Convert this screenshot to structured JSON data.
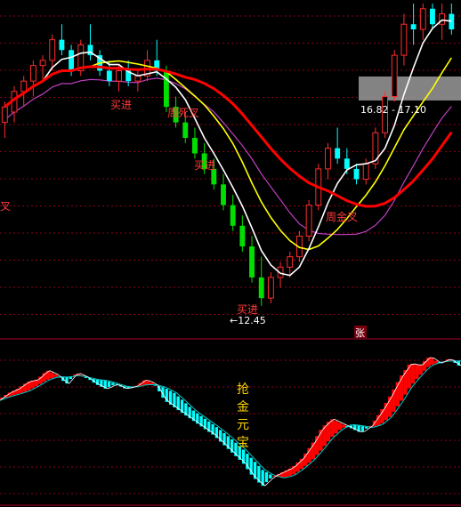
{
  "chart_data": [
    {
      "type": "candlestick",
      "panel": "price",
      "ylim": [
        12.0,
        18.3
      ],
      "grid": true,
      "colors": {
        "up": "#ff2d2d",
        "down": "#00ffff",
        "down_strong": "#00e000",
        "ma5": "#ffffff",
        "ma10": "#ffff00",
        "ma20": "#ff0000",
        "ma60": "#c040c0"
      },
      "candles": [
        [
          16.0,
          16.4,
          15.7,
          16.3
        ],
        [
          16.2,
          16.7,
          16.0,
          16.6
        ],
        [
          16.6,
          16.9,
          16.3,
          16.8
        ],
        [
          16.8,
          17.2,
          16.5,
          17.1
        ],
        [
          17.1,
          17.3,
          16.8,
          17.2
        ],
        [
          17.2,
          17.7,
          17.0,
          17.6
        ],
        [
          17.6,
          17.9,
          17.3,
          17.4
        ],
        [
          17.4,
          17.5,
          16.9,
          17.0
        ],
        [
          17.0,
          17.6,
          16.9,
          17.5
        ],
        [
          17.5,
          17.9,
          17.2,
          17.3
        ],
        [
          17.3,
          17.4,
          16.9,
          17.0
        ],
        [
          17.0,
          17.2,
          16.7,
          16.8
        ],
        [
          16.8,
          17.1,
          16.6,
          17.0
        ],
        [
          17.0,
          17.2,
          16.7,
          16.8
        ],
        [
          16.8,
          17.0,
          16.6,
          16.9
        ],
        [
          16.9,
          17.4,
          16.8,
          17.2
        ],
        [
          17.2,
          17.6,
          16.9,
          17.0
        ],
        [
          17.0,
          17.1,
          16.2,
          16.3
        ],
        [
          16.3,
          16.5,
          15.9,
          16.0
        ],
        [
          16.0,
          16.2,
          15.6,
          15.7
        ],
        [
          15.7,
          15.9,
          15.3,
          15.4
        ],
        [
          15.4,
          15.6,
          15.0,
          15.1
        ],
        [
          15.1,
          15.3,
          14.7,
          14.8
        ],
        [
          14.8,
          15.0,
          14.3,
          14.4
        ],
        [
          14.4,
          14.6,
          13.9,
          14.0
        ],
        [
          14.0,
          14.2,
          13.5,
          13.6
        ],
        [
          13.6,
          13.8,
          12.9,
          13.0
        ],
        [
          13.0,
          13.4,
          12.45,
          12.6
        ],
        [
          12.6,
          13.1,
          12.5,
          13.0
        ],
        [
          13.0,
          13.3,
          12.8,
          13.2
        ],
        [
          13.2,
          13.5,
          13.0,
          13.4
        ],
        [
          13.4,
          13.9,
          13.3,
          13.8
        ],
        [
          13.8,
          14.5,
          13.7,
          14.4
        ],
        [
          14.4,
          15.2,
          14.3,
          15.1
        ],
        [
          15.1,
          15.6,
          14.9,
          15.5
        ],
        [
          15.5,
          15.9,
          15.2,
          15.3
        ],
        [
          15.3,
          15.5,
          15.0,
          15.1
        ],
        [
          15.1,
          15.2,
          14.8,
          14.9
        ],
        [
          14.9,
          15.3,
          14.8,
          15.2
        ],
        [
          15.2,
          15.9,
          15.1,
          15.8
        ],
        [
          15.8,
          16.6,
          15.7,
          16.5
        ],
        [
          16.5,
          17.4,
          16.4,
          17.3
        ],
        [
          17.3,
          18.1,
          17.1,
          17.9
        ],
        [
          17.9,
          18.3,
          17.5,
          17.8
        ],
        [
          17.8,
          18.3,
          17.6,
          18.2
        ],
        [
          18.2,
          18.3,
          17.8,
          17.9
        ],
        [
          17.9,
          18.3,
          17.6,
          18.1
        ],
        [
          18.1,
          18.3,
          17.7,
          17.8
        ]
      ],
      "annotations": [
        {
          "text": "买进",
          "kind": "signal"
        },
        {
          "text": "周死叉",
          "kind": "signal"
        },
        {
          "text": "买进",
          "kind": "signal"
        },
        {
          "text": "金叉",
          "kind": "signal"
        },
        {
          "text": "买进",
          "kind": "signal"
        },
        {
          "text": "周金叉",
          "kind": "signal"
        },
        {
          "text": "←12.45",
          "kind": "low_marker"
        },
        {
          "text": "16.82 - 17.10",
          "kind": "price_range"
        },
        {
          "text": "张",
          "kind": "badge"
        }
      ]
    },
    {
      "type": "bar",
      "panel": "indicator",
      "title": "抢金元宝",
      "title_chars": [
        "抢",
        "金",
        "元",
        "宝"
      ],
      "colors": {
        "up": "#ff0000",
        "down": "#00ffff",
        "low": "#ff00ff",
        "line_a": "#ffffff",
        "line_b": "#00c8c8"
      }
    }
  ]
}
